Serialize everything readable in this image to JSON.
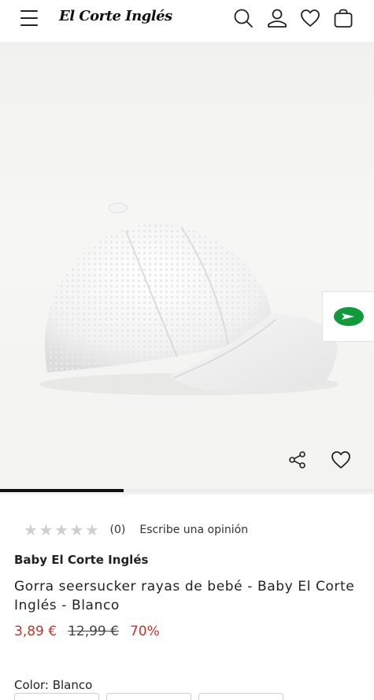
{
  "header": {
    "logo_text": "El Corte Inglés",
    "icons": [
      "menu-icon",
      "search-icon",
      "account-icon",
      "wishlist-icon",
      "bag-icon"
    ]
  },
  "gallery": {
    "progress_fraction": 0.33,
    "actions": [
      "share-icon",
      "heart-icon"
    ],
    "side_badge_icon": "green-arrow-icon"
  },
  "rating": {
    "stars_filled": 0,
    "stars_total": 5,
    "count": "(0)",
    "review_link": "Escribe una opinión"
  },
  "product": {
    "brand": "Baby El Corte Inglés",
    "title": "Gorra seersucker rayas de bebé - Baby El Corte Inglés - Blanco",
    "price_current": "3,89 €",
    "price_original": "12,99 €",
    "discount": "70%",
    "color_label": "Color: Blanco"
  },
  "colors": {
    "price_red": "#c0362c",
    "badge_green": "#119a3c"
  }
}
